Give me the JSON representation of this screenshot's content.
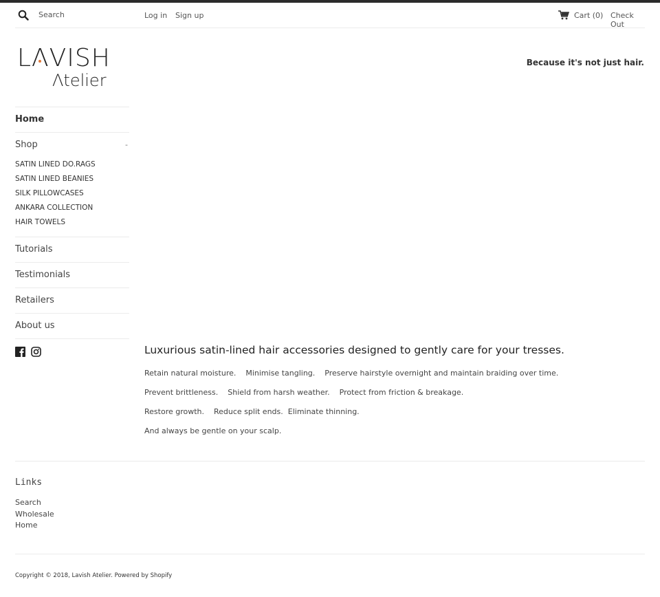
{
  "header": {
    "search_placeholder": "Search",
    "login_label": "Log in",
    "signup_label": "Sign up",
    "cart_label": "Cart (0)",
    "checkout_label": "Check Out"
  },
  "brand": {
    "logo_line1": "LΛVISH",
    "logo_line2": "Λtelier",
    "accent_color": "#e07a3a",
    "tagline": "Because it's not just hair."
  },
  "sidenav": {
    "home": "Home",
    "shop": "Shop",
    "shop_toggle": "-",
    "shop_items": [
      "SATIN LINED DO.RAGS",
      "SATIN LINED BEANIES",
      "SILK PILLOWCASES",
      "ANKARA COLLECTION",
      "HAIR TOWELS"
    ],
    "tutorials": "Tutorials",
    "testimonials": "Testimonials",
    "retailers": "Retailers",
    "about": "About us",
    "social": [
      "facebook-icon",
      "instagram-icon"
    ]
  },
  "main": {
    "heading": "Luxurious satin-lined hair accessories designed to gently care for your tresses.",
    "paragraphs": [
      "Retain natural moisture.    Minimise tangling.    Preserve hairstyle overnight and maintain braiding over time.",
      "Prevent brittleness.    Shield from harsh weather.    Protect from friction & breakage.",
      "Restore growth.    Reduce split ends.  Eliminate thinning.",
      "And always be gentle on your scalp."
    ]
  },
  "footer": {
    "links_title": "Links",
    "links": [
      "Search",
      "Wholesale",
      "Home"
    ],
    "copyright": "Copyright © 2018, Lavish Atelier. Powered by Shopify"
  }
}
